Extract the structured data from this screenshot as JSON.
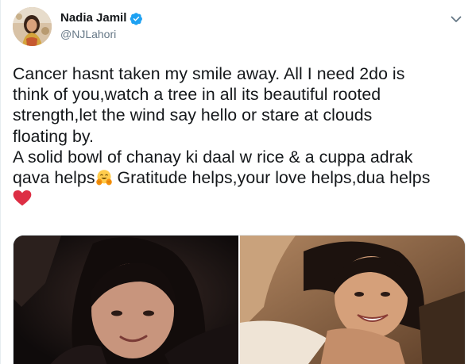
{
  "author": {
    "display_name": "Nadia Jamil",
    "handle": "@NJLahori",
    "verified": true,
    "avatar_icon": "profile-photo"
  },
  "menu": {
    "icon": "chevron-down-icon"
  },
  "tweet": {
    "lines": [
      "Cancer hasnt taken my smile away. All I need 2do is",
      "think of you,watch a tree in all its beautiful rooted",
      "strength,let the wind say hello or stare at clouds",
      "floating by.",
      "A solid bowl of chanay ki daal w rice & a cuppa adrak",
      "qava helps",
      " Gratitude helps,your love helps,dua helps"
    ],
    "emojis": [
      "hugging-face-emoji",
      "red-heart-emoji"
    ]
  },
  "media": {
    "photos": [
      {
        "icon": "photo-selfie-dark"
      },
      {
        "icon": "photo-selfie-smiling"
      }
    ]
  },
  "colors": {
    "text": "#14171a",
    "secondary": "#657786",
    "verified_blue": "#1da1f2",
    "border": "#e1e8ed",
    "heart": "#e0245e"
  }
}
